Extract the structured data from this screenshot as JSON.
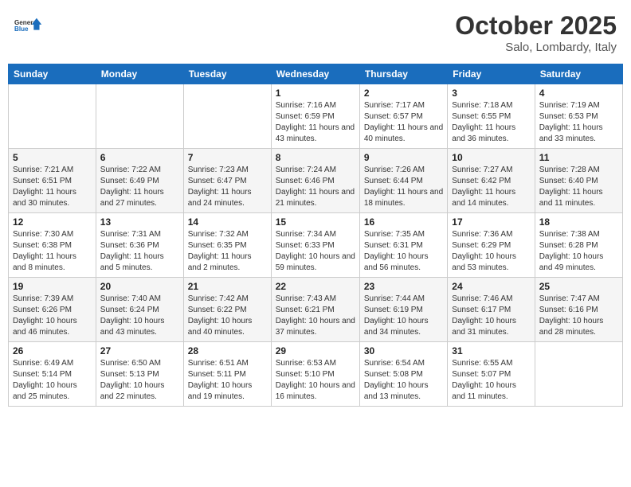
{
  "header": {
    "logo_line1": "General",
    "logo_line2": "Blue",
    "month": "October 2025",
    "location": "Salo, Lombardy, Italy"
  },
  "days_of_week": [
    "Sunday",
    "Monday",
    "Tuesday",
    "Wednesday",
    "Thursday",
    "Friday",
    "Saturday"
  ],
  "weeks": [
    [
      {
        "day": "",
        "info": ""
      },
      {
        "day": "",
        "info": ""
      },
      {
        "day": "",
        "info": ""
      },
      {
        "day": "1",
        "info": "Sunrise: 7:16 AM\nSunset: 6:59 PM\nDaylight: 11 hours and 43 minutes."
      },
      {
        "day": "2",
        "info": "Sunrise: 7:17 AM\nSunset: 6:57 PM\nDaylight: 11 hours and 40 minutes."
      },
      {
        "day": "3",
        "info": "Sunrise: 7:18 AM\nSunset: 6:55 PM\nDaylight: 11 hours and 36 minutes."
      },
      {
        "day": "4",
        "info": "Sunrise: 7:19 AM\nSunset: 6:53 PM\nDaylight: 11 hours and 33 minutes."
      }
    ],
    [
      {
        "day": "5",
        "info": "Sunrise: 7:21 AM\nSunset: 6:51 PM\nDaylight: 11 hours and 30 minutes."
      },
      {
        "day": "6",
        "info": "Sunrise: 7:22 AM\nSunset: 6:49 PM\nDaylight: 11 hours and 27 minutes."
      },
      {
        "day": "7",
        "info": "Sunrise: 7:23 AM\nSunset: 6:47 PM\nDaylight: 11 hours and 24 minutes."
      },
      {
        "day": "8",
        "info": "Sunrise: 7:24 AM\nSunset: 6:46 PM\nDaylight: 11 hours and 21 minutes."
      },
      {
        "day": "9",
        "info": "Sunrise: 7:26 AM\nSunset: 6:44 PM\nDaylight: 11 hours and 18 minutes."
      },
      {
        "day": "10",
        "info": "Sunrise: 7:27 AM\nSunset: 6:42 PM\nDaylight: 11 hours and 14 minutes."
      },
      {
        "day": "11",
        "info": "Sunrise: 7:28 AM\nSunset: 6:40 PM\nDaylight: 11 hours and 11 minutes."
      }
    ],
    [
      {
        "day": "12",
        "info": "Sunrise: 7:30 AM\nSunset: 6:38 PM\nDaylight: 11 hours and 8 minutes."
      },
      {
        "day": "13",
        "info": "Sunrise: 7:31 AM\nSunset: 6:36 PM\nDaylight: 11 hours and 5 minutes."
      },
      {
        "day": "14",
        "info": "Sunrise: 7:32 AM\nSunset: 6:35 PM\nDaylight: 11 hours and 2 minutes."
      },
      {
        "day": "15",
        "info": "Sunrise: 7:34 AM\nSunset: 6:33 PM\nDaylight: 10 hours and 59 minutes."
      },
      {
        "day": "16",
        "info": "Sunrise: 7:35 AM\nSunset: 6:31 PM\nDaylight: 10 hours and 56 minutes."
      },
      {
        "day": "17",
        "info": "Sunrise: 7:36 AM\nSunset: 6:29 PM\nDaylight: 10 hours and 53 minutes."
      },
      {
        "day": "18",
        "info": "Sunrise: 7:38 AM\nSunset: 6:28 PM\nDaylight: 10 hours and 49 minutes."
      }
    ],
    [
      {
        "day": "19",
        "info": "Sunrise: 7:39 AM\nSunset: 6:26 PM\nDaylight: 10 hours and 46 minutes."
      },
      {
        "day": "20",
        "info": "Sunrise: 7:40 AM\nSunset: 6:24 PM\nDaylight: 10 hours and 43 minutes."
      },
      {
        "day": "21",
        "info": "Sunrise: 7:42 AM\nSunset: 6:22 PM\nDaylight: 10 hours and 40 minutes."
      },
      {
        "day": "22",
        "info": "Sunrise: 7:43 AM\nSunset: 6:21 PM\nDaylight: 10 hours and 37 minutes."
      },
      {
        "day": "23",
        "info": "Sunrise: 7:44 AM\nSunset: 6:19 PM\nDaylight: 10 hours and 34 minutes."
      },
      {
        "day": "24",
        "info": "Sunrise: 7:46 AM\nSunset: 6:17 PM\nDaylight: 10 hours and 31 minutes."
      },
      {
        "day": "25",
        "info": "Sunrise: 7:47 AM\nSunset: 6:16 PM\nDaylight: 10 hours and 28 minutes."
      }
    ],
    [
      {
        "day": "26",
        "info": "Sunrise: 6:49 AM\nSunset: 5:14 PM\nDaylight: 10 hours and 25 minutes."
      },
      {
        "day": "27",
        "info": "Sunrise: 6:50 AM\nSunset: 5:13 PM\nDaylight: 10 hours and 22 minutes."
      },
      {
        "day": "28",
        "info": "Sunrise: 6:51 AM\nSunset: 5:11 PM\nDaylight: 10 hours and 19 minutes."
      },
      {
        "day": "29",
        "info": "Sunrise: 6:53 AM\nSunset: 5:10 PM\nDaylight: 10 hours and 16 minutes."
      },
      {
        "day": "30",
        "info": "Sunrise: 6:54 AM\nSunset: 5:08 PM\nDaylight: 10 hours and 13 minutes."
      },
      {
        "day": "31",
        "info": "Sunrise: 6:55 AM\nSunset: 5:07 PM\nDaylight: 10 hours and 11 minutes."
      },
      {
        "day": "",
        "info": ""
      }
    ]
  ]
}
